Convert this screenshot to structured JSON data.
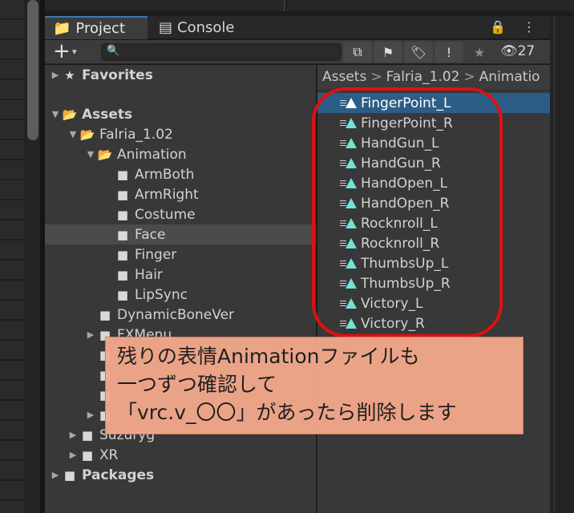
{
  "tabs": {
    "project_label": "Project",
    "console_label": "Console",
    "tools": "🔒 ⋮"
  },
  "toolbar": {
    "add_label": "+",
    "add_caret": "▾",
    "search_placeholder": "",
    "search_icon": "🔍",
    "buttons": [
      "⧉",
      "⚑",
      "🏷",
      "!",
      "★"
    ],
    "hidden_count": "👁27"
  },
  "tree": [
    {
      "label": "Favorites",
      "bold": true,
      "arrow": "▶",
      "icon": "★",
      "indent": 6
    },
    {
      "label": "Assets",
      "bold": true,
      "arrow": "▼",
      "icon": "📂",
      "indent": 6
    },
    {
      "label": "Falria_1.02",
      "bold": false,
      "arrow": "▼",
      "icon": "📂",
      "indent": 28
    },
    {
      "label": "Animation",
      "bold": false,
      "arrow": "▼",
      "icon": "📂",
      "indent": 50
    },
    {
      "label": "ArmBoth",
      "bold": false,
      "arrow": "",
      "icon": "■",
      "indent": 72
    },
    {
      "label": "ArmRight",
      "bold": false,
      "arrow": "",
      "icon": "■",
      "indent": 72
    },
    {
      "label": "Costume",
      "bold": false,
      "arrow": "",
      "icon": "■",
      "indent": 72
    },
    {
      "label": "Face",
      "bold": false,
      "arrow": "",
      "icon": "■",
      "indent": 72,
      "selected": true
    },
    {
      "label": "Finger",
      "bold": false,
      "arrow": "",
      "icon": "■",
      "indent": 72
    },
    {
      "label": "Hair",
      "bold": false,
      "arrow": "",
      "icon": "■",
      "indent": 72
    },
    {
      "label": "LipSync",
      "bold": false,
      "arrow": "",
      "icon": "■",
      "indent": 72
    },
    {
      "label": "DynamicBoneVer",
      "bold": false,
      "arrow": "",
      "icon": "■",
      "indent": 50
    },
    {
      "label": "FXMenu",
      "bold": false,
      "arrow": "▶",
      "icon": "■",
      "indent": 50
    },
    {
      "label": "",
      "bold": false,
      "arrow": "",
      "icon": "■",
      "indent": 50
    },
    {
      "label": "",
      "bold": false,
      "arrow": "",
      "icon": "■",
      "indent": 50
    },
    {
      "label": "",
      "bold": false,
      "arrow": "",
      "icon": "■",
      "indent": 50
    },
    {
      "label": "",
      "bold": false,
      "arrow": "▶",
      "icon": "■",
      "indent": 50
    },
    {
      "label": "Suzuryg",
      "bold": false,
      "arrow": "▶",
      "icon": "■",
      "indent": 28
    },
    {
      "label": "XR",
      "bold": false,
      "arrow": "▶",
      "icon": "■",
      "indent": 28
    },
    {
      "label": "Packages",
      "bold": true,
      "arrow": "▶",
      "icon": "■",
      "indent": 6
    }
  ],
  "breadcrumb": [
    "Assets",
    "Falria_1.02",
    "Animatio"
  ],
  "breadcrumb_sep": ">",
  "files": [
    "FingerPoint_L",
    "FingerPoint_R",
    "HandGun_L",
    "HandGun_R",
    "HandOpen_L",
    "HandOpen_R",
    "Rocknroll_L",
    "Rocknroll_R",
    "ThumbsUp_L",
    "ThumbsUp_R",
    "Victory_L",
    "Victory_R"
  ],
  "selected_file": "FingerPoint_L",
  "annotation": {
    "line1": "残りの表情Animationファイルも",
    "line2": "一つずつ確認して",
    "line3": "「vrc.v_〇〇」があったら削除します"
  },
  "colors": {
    "selection": "#2c5d87",
    "anim_icon": "#6fe3d6",
    "highlight": "#e01010",
    "note_bg": "#f7aa8c"
  }
}
